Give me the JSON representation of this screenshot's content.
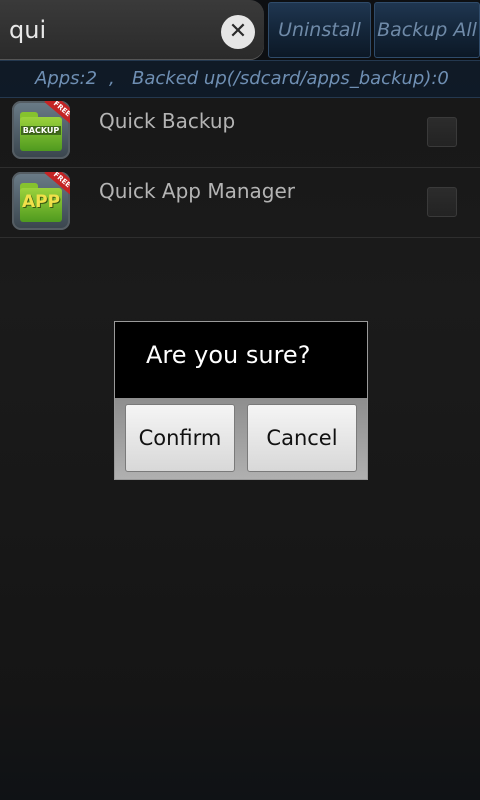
{
  "search": {
    "value": "qui",
    "clear_icon": "close-icon",
    "clear_glyph": "✕"
  },
  "toolbar": {
    "uninstall_label": "Uninstall",
    "backup_all_label": "Backup All"
  },
  "status": {
    "apps_count": "Apps:2",
    "separator": ",",
    "backed_up": "Backed up(/sdcard/apps_backup):0"
  },
  "apps": [
    {
      "name": "Quick Backup",
      "icon": "quick-backup-app-icon",
      "icon_text": "BACKUP",
      "badge_text": "FREE",
      "checked": false
    },
    {
      "name": "Quick App Manager",
      "icon": "quick-app-manager-app-icon",
      "icon_text": "APP",
      "badge_text": "FREE",
      "checked": false
    }
  ],
  "dialog": {
    "message": "Are you sure?",
    "confirm_label": "Confirm",
    "cancel_label": "Cancel"
  },
  "colors": {
    "background": "#161616",
    "toolbar_button_text": "#6f8aa8",
    "status_text": "#6f8fb3",
    "list_text": "#b4b4b4",
    "dialog_background": "#000000"
  }
}
